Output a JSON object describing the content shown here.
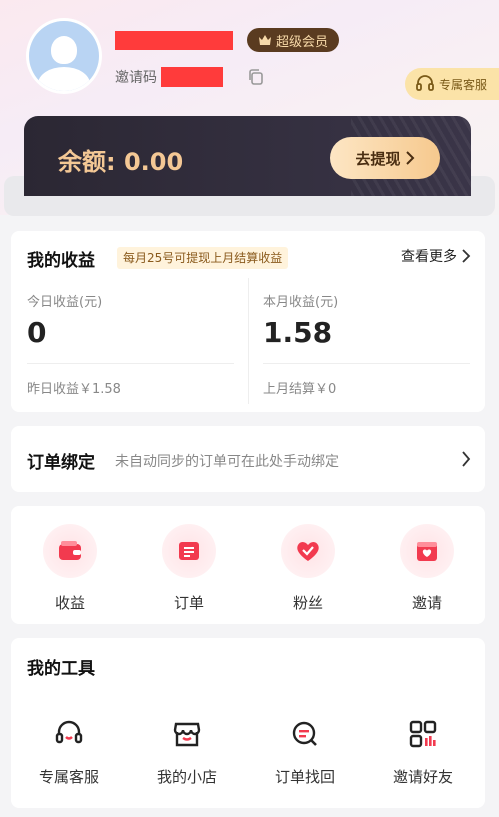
{
  "profile": {
    "vip_label": "超级会员",
    "invite_label": "邀请码",
    "service_label": "专属客服"
  },
  "balance": {
    "text": "余额: 0.00",
    "withdraw_label": "去提现"
  },
  "earnings": {
    "title": "我的收益",
    "note": "每月25号可提现上月结算收益",
    "more_label": "查看更多",
    "today_label": "今日收益(元)",
    "today_value": "0",
    "yesterday_text": "昨日收益￥1.58",
    "month_label": "本月收益(元)",
    "month_value": "1.58",
    "last_month_text": "上月结算￥0"
  },
  "order_bind": {
    "title": "订单绑定",
    "desc": "未自动同步的订单可在此处手动绑定"
  },
  "quick": {
    "items": [
      {
        "label": "收益",
        "icon": "wallet-icon"
      },
      {
        "label": "订单",
        "icon": "order-icon"
      },
      {
        "label": "粉丝",
        "icon": "heart-icon"
      },
      {
        "label": "邀请",
        "icon": "invite-icon"
      }
    ]
  },
  "tools": {
    "title": "我的工具",
    "items": [
      {
        "label": "专属客服",
        "icon": "headset-icon"
      },
      {
        "label": "我的小店",
        "icon": "shop-icon"
      },
      {
        "label": "订单找回",
        "icon": "order-search-icon"
      },
      {
        "label": "邀请好友",
        "icon": "qr-code-icon"
      }
    ]
  },
  "colors": {
    "accent_red": "#f23a4f",
    "gold_text": "#f4c895",
    "card_dark": "#2b2733"
  }
}
